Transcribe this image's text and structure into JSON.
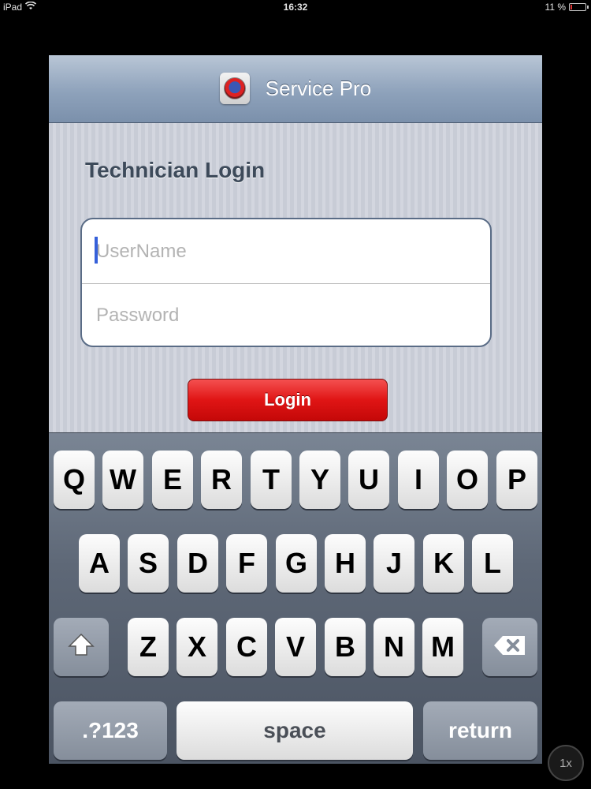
{
  "status_bar": {
    "device": "iPad",
    "time": "16:32",
    "battery": "11 %",
    "battery_level": 0.11
  },
  "navbar": {
    "title": "Service Pro",
    "logo_icon": "service-pro-logo"
  },
  "login": {
    "heading": "Technician Login",
    "username_placeholder": "UserName",
    "password_placeholder": "Password",
    "button_label": "Login"
  },
  "keyboard": {
    "row1": [
      "Q",
      "W",
      "E",
      "R",
      "T",
      "Y",
      "U",
      "I",
      "O",
      "P"
    ],
    "row2": [
      "A",
      "S",
      "D",
      "F",
      "G",
      "H",
      "J",
      "K",
      "L"
    ],
    "row3": [
      "Z",
      "X",
      "C",
      "V",
      "B",
      "N",
      "M"
    ],
    "shift_icon": "shift-arrow-icon",
    "backspace_icon": "backspace-icon",
    "numbers_label": ".?123",
    "space_label": "space",
    "return_label": "return"
  },
  "zoom_badge": "1x",
  "colors": {
    "login_button": "#e01515",
    "caret": "#3660d9",
    "navbar": "#8ea2bb"
  }
}
